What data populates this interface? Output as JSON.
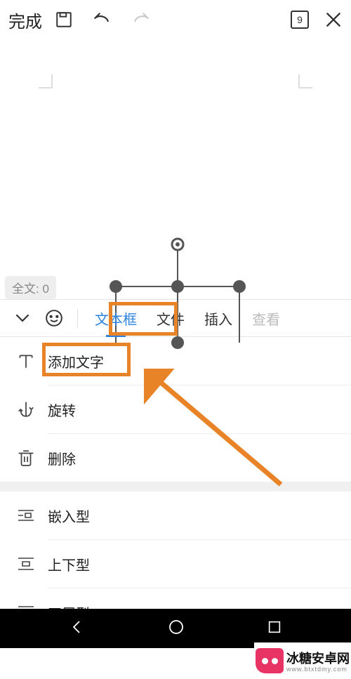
{
  "toolbar": {
    "done_label": "完成",
    "page_count": "9"
  },
  "word_count": {
    "label": "全文: 0"
  },
  "tabs": {
    "textbox": "文本框",
    "file": "文件",
    "insert": "插入",
    "view": "查看"
  },
  "menu": {
    "add_text": "添加文字",
    "rotate": "旋转",
    "delete": "删除",
    "embed": "嵌入型",
    "topbottom": "上下型",
    "around": "四周型"
  },
  "watermark": {
    "name": "冰糖安卓网",
    "url": "www.btxtdmy.com"
  }
}
